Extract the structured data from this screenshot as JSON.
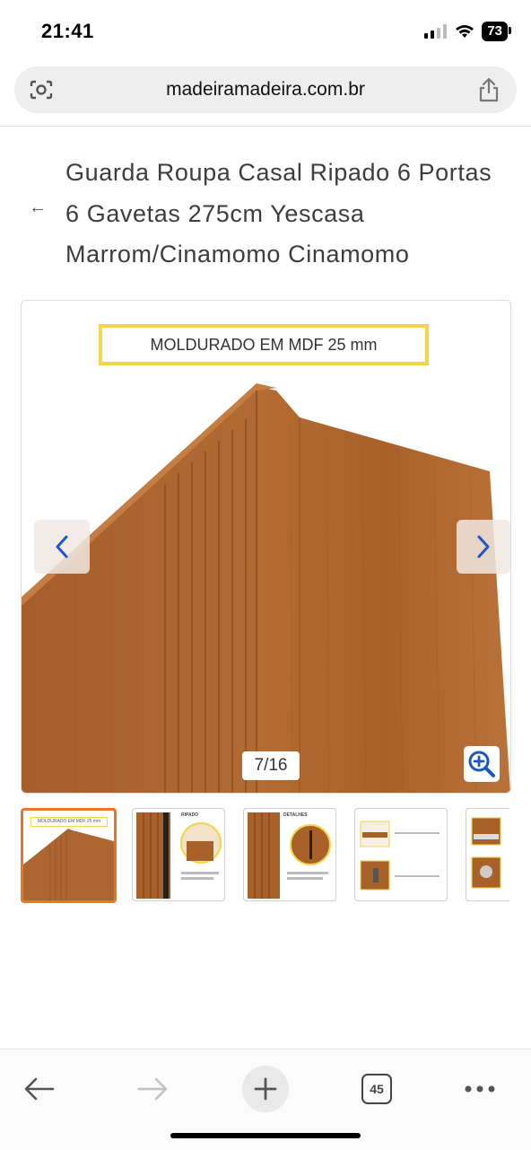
{
  "status_bar": {
    "time": "21:41",
    "battery": "73"
  },
  "browser": {
    "url": "madeiramadeira.com.br",
    "open_tabs": "45"
  },
  "product": {
    "title": "Guarda Roupa Casal Ripado 6 Portas 6 Gavetas 275cm Yescasa Marrom/Cinamomo Cinamomo"
  },
  "gallery": {
    "banner_text": "MOLDURADO EM MDF 25 mm",
    "counter": "7/16",
    "thumbnails": [
      {
        "caption": "MOLDURADO EM MDF 25 mm",
        "active": true
      },
      {
        "caption": "RIPADO",
        "active": false
      },
      {
        "caption": "DETALHES",
        "active": false
      },
      {
        "caption": "",
        "active": false
      },
      {
        "caption": "",
        "active": false
      }
    ]
  },
  "colors": {
    "accent": "#e8762d",
    "banner_border": "#f2d54b",
    "wood": "#b06a32",
    "icon_blue": "#1a56c4"
  }
}
